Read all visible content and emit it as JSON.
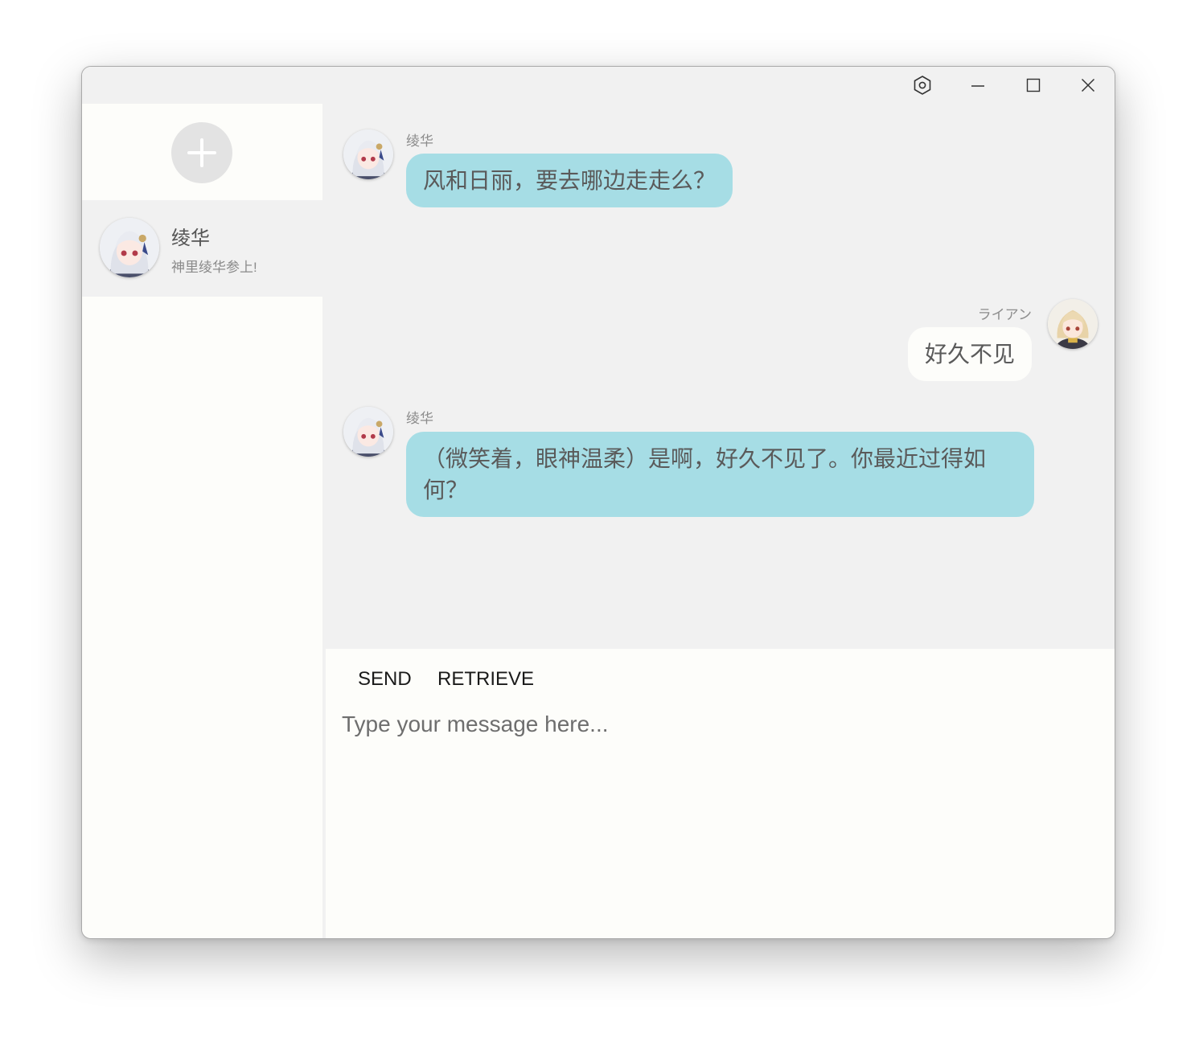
{
  "titlebar": {
    "buttons": [
      {
        "name": "settings",
        "icon": "hexagon-settings-icon"
      },
      {
        "name": "minimize",
        "icon": "minimize-icon"
      },
      {
        "name": "maximize",
        "icon": "maximize-icon"
      },
      {
        "name": "close",
        "icon": "close-icon"
      }
    ]
  },
  "sidebar": {
    "new_chat_icon": "plus-icon",
    "contacts": [
      {
        "name": "绫华",
        "status": "神里绫华参上!",
        "avatar": "ayaka-avatar"
      }
    ]
  },
  "messages": [
    {
      "sender": "绫华",
      "role": "bot",
      "text": "风和日丽，要去哪边走走么？"
    },
    {
      "sender": "ライアン",
      "role": "user",
      "text": "好久不见"
    },
    {
      "sender": "绫华",
      "role": "bot",
      "text": "（微笑着，眼神温柔）是啊，好久不见了。你最近过得如何？"
    }
  ],
  "composer": {
    "send_label": "SEND",
    "retrieve_label": "RETRIEVE",
    "placeholder": "Type your message here..."
  },
  "colors": {
    "window_bg": "#f1f1f1",
    "panel_bg": "#fdfdfa",
    "bot_bubble": "#a6dde5",
    "user_bubble": "#fdfdfa",
    "text": "#5a5a5a"
  }
}
